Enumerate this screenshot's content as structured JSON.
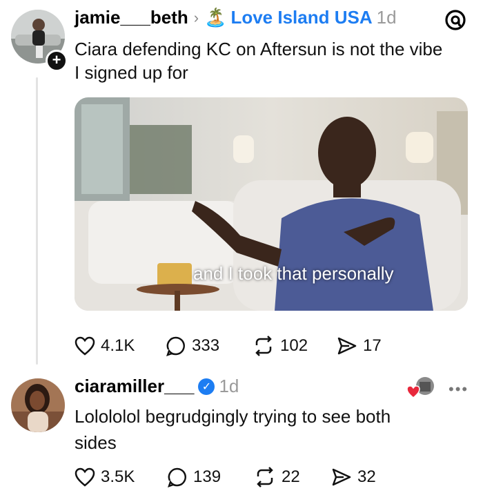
{
  "post1": {
    "username": "jamie___beth",
    "separator": "›",
    "community_icon": "palm-island-emoji",
    "community_emoji": "🏝️",
    "community": "Love Island USA",
    "time": "1d",
    "text_line1": "Ciara defending KC on Aftersun is not the vibe",
    "text_line2": "I signed up for",
    "media_caption": "and I took that personally",
    "stats": {
      "likes": "4.1K",
      "replies": "333",
      "reposts": "102",
      "shares": "17"
    }
  },
  "post2": {
    "username": "ciaramiller___",
    "time": "1d",
    "text_line1": "Lolololol begrudgingly trying to see both",
    "text_line2": "sides",
    "stats": {
      "likes": "3.5K",
      "replies": "139",
      "reposts": "22",
      "shares": "32"
    }
  },
  "more_menu": "•••",
  "colors": {
    "accent": "#1d7df2",
    "text": "#000000",
    "muted": "#9a9a9a",
    "heart": "#e8283c"
  },
  "icons": [
    "threads-logo-icon",
    "plus-icon",
    "heart-icon",
    "reply-icon",
    "repost-icon",
    "share-icon",
    "verified-icon",
    "more-icon"
  ]
}
